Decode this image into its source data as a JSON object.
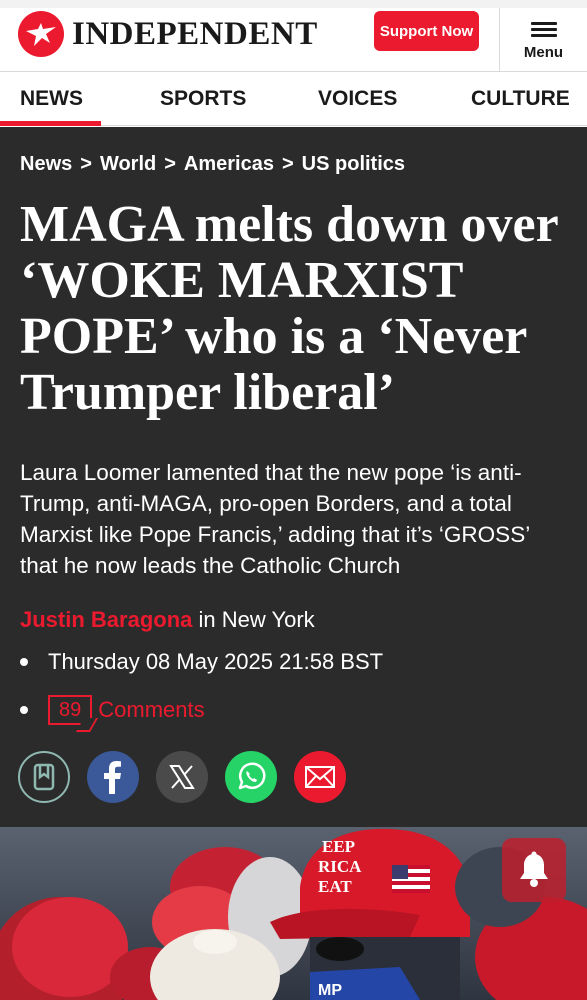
{
  "header": {
    "logo_text": "INDEPENDENT",
    "support_label": "Support Now",
    "menu_label": "Menu"
  },
  "nav": {
    "items": [
      {
        "label": "NEWS",
        "active": true
      },
      {
        "label": "SPORTS",
        "active": false
      },
      {
        "label": "VOICES",
        "active": false
      },
      {
        "label": "CULTURE",
        "active": false
      }
    ]
  },
  "breadcrumb": [
    "News",
    "World",
    "Americas",
    "US politics"
  ],
  "breadcrumb_separator": ">",
  "article": {
    "headline": "MAGA melts down over ‘WOKE MARXIST POPE’ who is a ‘Never Trumper liberal’",
    "standfirst": "Laura Loomer lamented that the new pope ‘is anti-Trump, anti-MAGA, pro-open Borders, and a total Marxist like Pope Francis,’ adding that it’s ‘GROSS’ that he now leads the Catholic Church",
    "author": "Justin Baragona",
    "location": "in New York",
    "date": "Thursday 08 May 2025 21:58 BST",
    "comment_count": "89",
    "comments_label": "Comments"
  },
  "share": [
    "bookmark-icon",
    "facebook-icon",
    "x-icon",
    "whatsapp-icon",
    "email-icon"
  ],
  "colors": {
    "brand_red": "#ec1a2e",
    "dark_bg": "#2b2b2b",
    "facebook_blue": "#3b5998",
    "whatsapp_green": "#25d366"
  }
}
